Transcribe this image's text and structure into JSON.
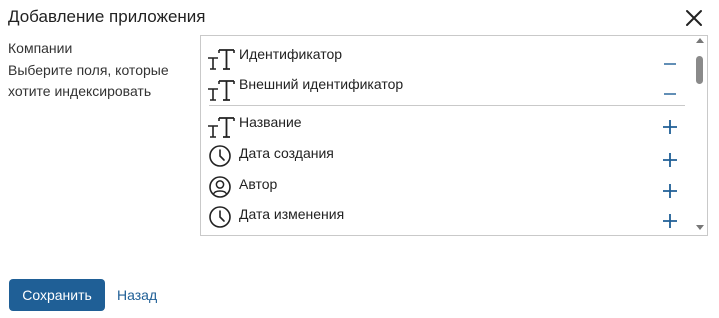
{
  "dialog": {
    "title": "Добавление приложения",
    "close_icon": "close-icon"
  },
  "left": {
    "app_name": "Компании",
    "instruction": "Выберите поля, которые хотите индексировать"
  },
  "fields": {
    "selected": [
      {
        "label": "Идентификатор",
        "icon": "text-type-icon",
        "action": "minus-icon"
      },
      {
        "label": "Внешний идентификатор",
        "icon": "text-type-icon",
        "action": "minus-icon"
      }
    ],
    "available": [
      {
        "label": "Название",
        "icon": "text-type-icon",
        "action": "plus-icon"
      },
      {
        "label": "Дата создания",
        "icon": "clock-icon",
        "action": "plus-icon"
      },
      {
        "label": "Автор",
        "icon": "user-icon",
        "action": "plus-icon"
      },
      {
        "label": "Дата изменения",
        "icon": "clock-icon",
        "action": "plus-icon"
      }
    ]
  },
  "footer": {
    "save_label": "Сохранить",
    "back_label": "Назад"
  },
  "colors": {
    "primary": "#1f5f96",
    "border": "#c9c9c9",
    "text": "#222222"
  }
}
